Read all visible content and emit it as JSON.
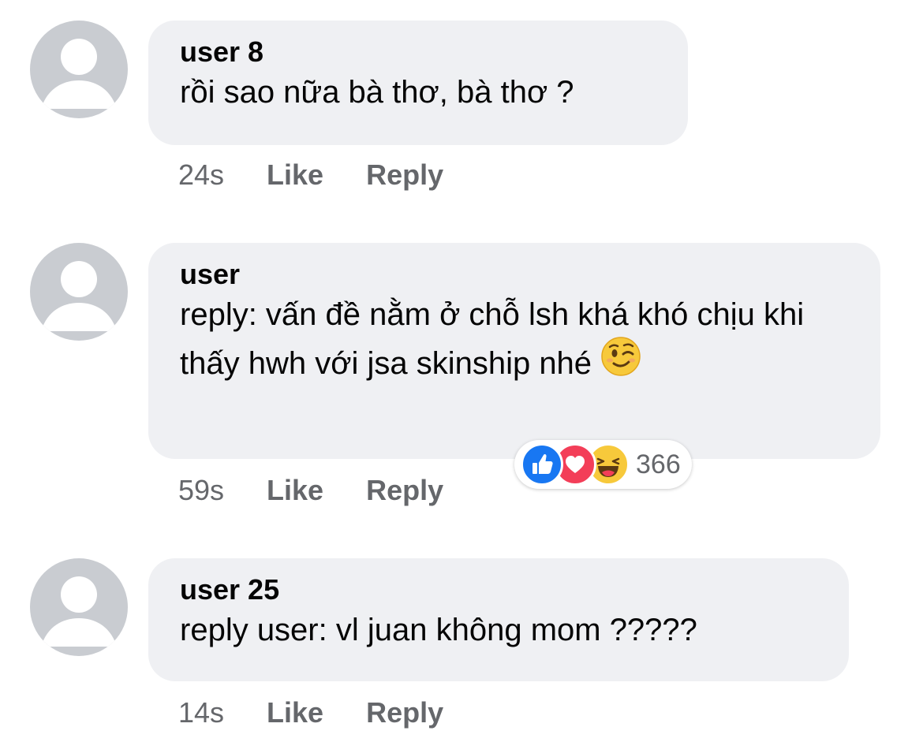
{
  "comments": [
    {
      "author": "user 8",
      "text": "rồi sao nữa bà thơ, bà thơ ?",
      "time": "24s",
      "like_label": "Like",
      "reply_label": "Reply"
    },
    {
      "author": "user",
      "text": "reply: vấn đề nằm ở chỗ lsh khá khó chịu khi thấy hwh với jsa skinship nhé",
      "emoji": "winking-face",
      "time": "59s",
      "like_label": "Like",
      "reply_label": "Reply",
      "reactions": {
        "icons": [
          "like",
          "love",
          "haha"
        ],
        "count": "366"
      }
    },
    {
      "author": "user 25",
      "text": "reply user: vl juan không mom ?????",
      "time": "14s",
      "like_label": "Like",
      "reply_label": "Reply"
    }
  ],
  "colors": {
    "bubble": "#eff0f3",
    "meta_text": "#65676b",
    "avatar_bg": "#c9ccd1",
    "like_blue": "#1877f2",
    "love_red": "#f33e58",
    "haha_yellow": "#f7c93b"
  }
}
